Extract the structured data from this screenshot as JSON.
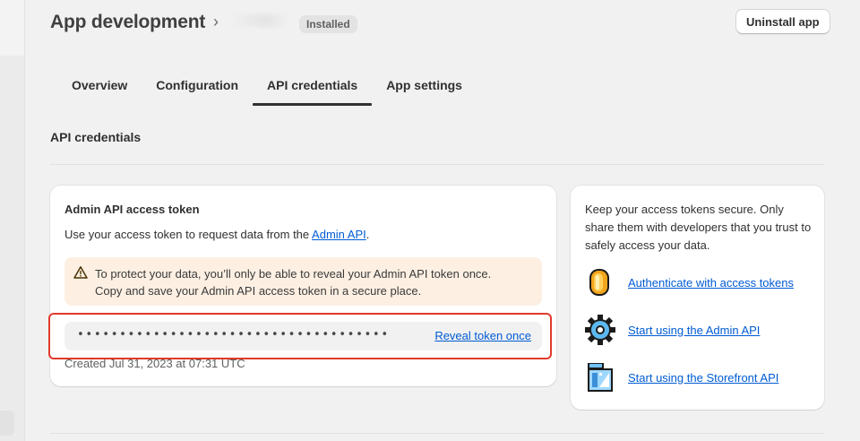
{
  "header": {
    "title": "App development",
    "breadcrumb_separator": "›",
    "status_badge": "Installed",
    "uninstall_label": "Uninstall app"
  },
  "tabs": [
    {
      "label": "Overview",
      "active": false
    },
    {
      "label": "Configuration",
      "active": false
    },
    {
      "label": "API credentials",
      "active": true
    },
    {
      "label": "App settings",
      "active": false
    }
  ],
  "section": {
    "title": "API credentials"
  },
  "token_card": {
    "heading": "Admin API access token",
    "desc_prefix": "Use your access token to request data from the ",
    "desc_link": "Admin API",
    "desc_suffix": ".",
    "warning_line1": "To protect your data, you’ll only be able to reveal your Admin API token once.",
    "warning_line2": "Copy and save your Admin API access token in a secure place.",
    "token_mask": "•••••••••••••••••••••••••••••••••••••",
    "reveal_label": "Reveal token once",
    "created": "Created Jul 31, 2023 at 07:31 UTC"
  },
  "tips_card": {
    "text": "Keep your access tokens secure. Only share them with developers that you trust to safely access your data.",
    "links": [
      {
        "label": "Authenticate with access tokens",
        "icon": "coin-icon"
      },
      {
        "label": "Start using the Admin API",
        "icon": "gear-icon"
      },
      {
        "label": "Start using the Storefront API",
        "icon": "storefront-icon"
      }
    ]
  },
  "colors": {
    "link": "#005bd3",
    "warning_bg": "#fdf0e3",
    "highlight": "#e03a2a",
    "page_bg": "#f1f1f1"
  }
}
